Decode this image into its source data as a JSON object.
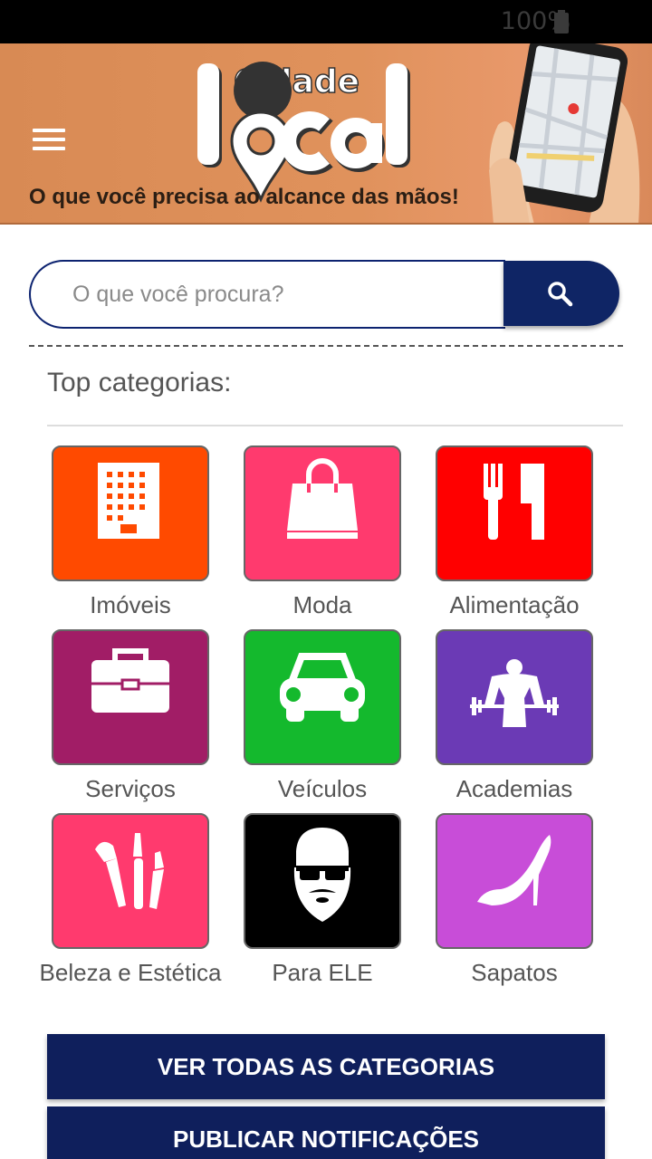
{
  "status_bar": {
    "battery_text": "100%"
  },
  "header": {
    "logo_word_top": "Cidade",
    "logo_word_main": "Local",
    "tagline": "O que você precisa ao alcance das mãos!"
  },
  "search": {
    "placeholder": "O que você procura?",
    "value": ""
  },
  "categories_section": {
    "title": "Top categorias:",
    "items": [
      {
        "label": "Imóveis",
        "color": "#ff4a00",
        "icon": "building-icon"
      },
      {
        "label": "Moda",
        "color": "#ff3a6e",
        "icon": "shopping-bag-icon"
      },
      {
        "label": "Alimentação",
        "color": "#ff0000",
        "icon": "fork-knife-icon"
      },
      {
        "label": "Serviços",
        "color": "#a11d66",
        "icon": "briefcase-icon"
      },
      {
        "label": "Veículos",
        "color": "#14b92d",
        "icon": "car-icon"
      },
      {
        "label": "Academias",
        "color": "#6b3ab5",
        "icon": "bodybuilder-icon"
      },
      {
        "label": "Beleza e Estética",
        "color": "#ff3a6e",
        "icon": "makeup-brushes-icon"
      },
      {
        "label": "Para ELE",
        "color": "#000000",
        "icon": "bearded-man-icon"
      },
      {
        "label": "Sapatos",
        "color": "#c84dd8",
        "icon": "high-heel-icon"
      }
    ]
  },
  "buttons": {
    "all_categories": "VER TODAS AS CATEGORIAS",
    "publish_notifications": "PUBLICAR NOTIFICAÇÕES"
  },
  "colors": {
    "primary": "#0f1f5c",
    "banner": "#e0925c"
  }
}
